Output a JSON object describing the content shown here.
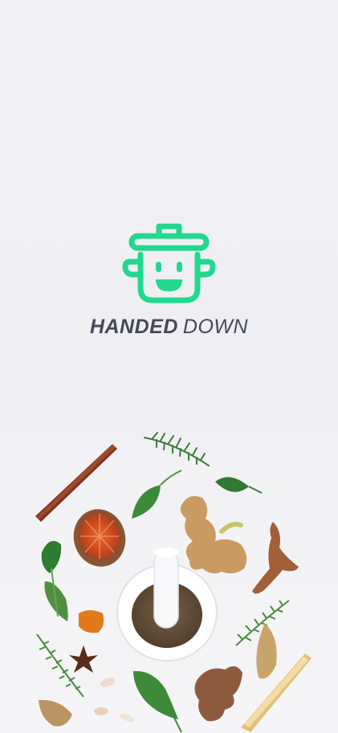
{
  "brand": {
    "name_bold": "HANDED",
    "name_light": "DOWN",
    "accent_color": "#21d88e",
    "text_color": "#454856",
    "logo_icon": "cooking-pot-smiley-icon"
  },
  "hero": {
    "image": "herbs-spices-mortar-pestle-photo"
  }
}
